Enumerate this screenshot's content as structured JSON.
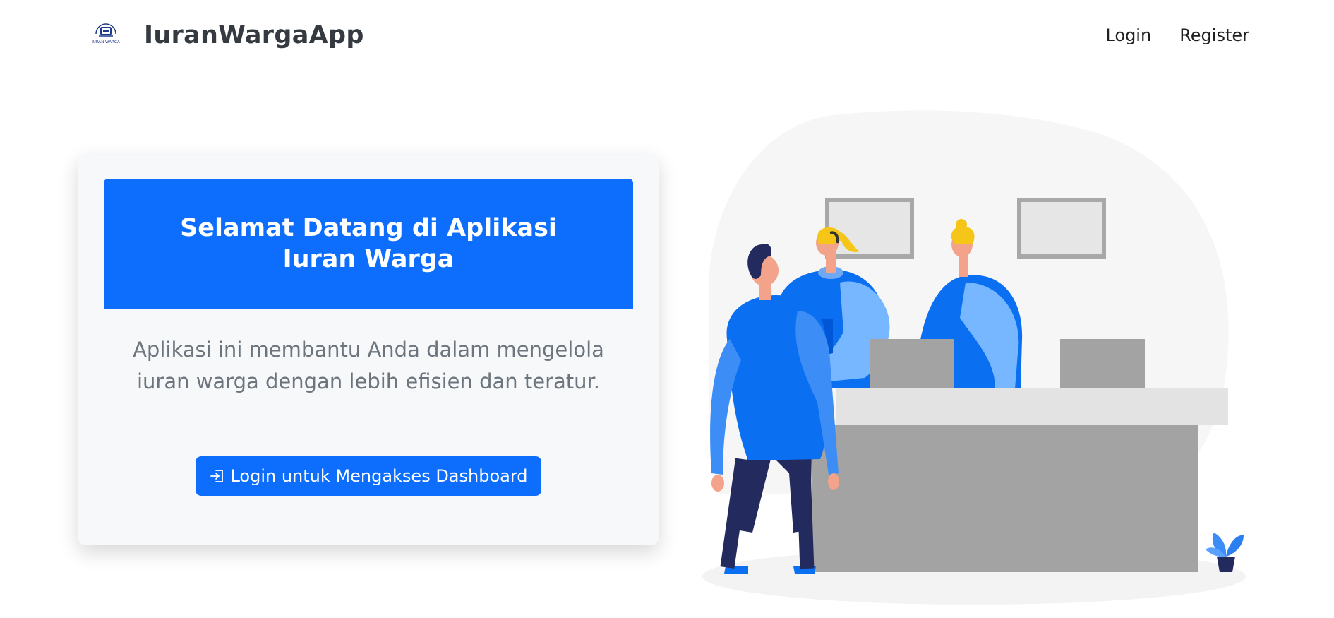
{
  "navbar": {
    "logo_text": "IURAN WARGA",
    "brand": "IuranWargaApp",
    "links": [
      {
        "label": "Login"
      },
      {
        "label": "Register"
      }
    ]
  },
  "hero": {
    "title": "Selamat Datang di Aplikasi Iuran Warga",
    "description": "Aplikasi ini membantu Anda dalam mengelola iuran warga dengan lebih efisien dan teratur.",
    "cta_label": "Login untuk Mengakses Dashboard",
    "cta_icon": "login-icon"
  },
  "colors": {
    "primary": "#0d6efd",
    "brand_text": "#343a40",
    "muted_text": "#6c757d",
    "card_bg": "#f7f8fa"
  }
}
